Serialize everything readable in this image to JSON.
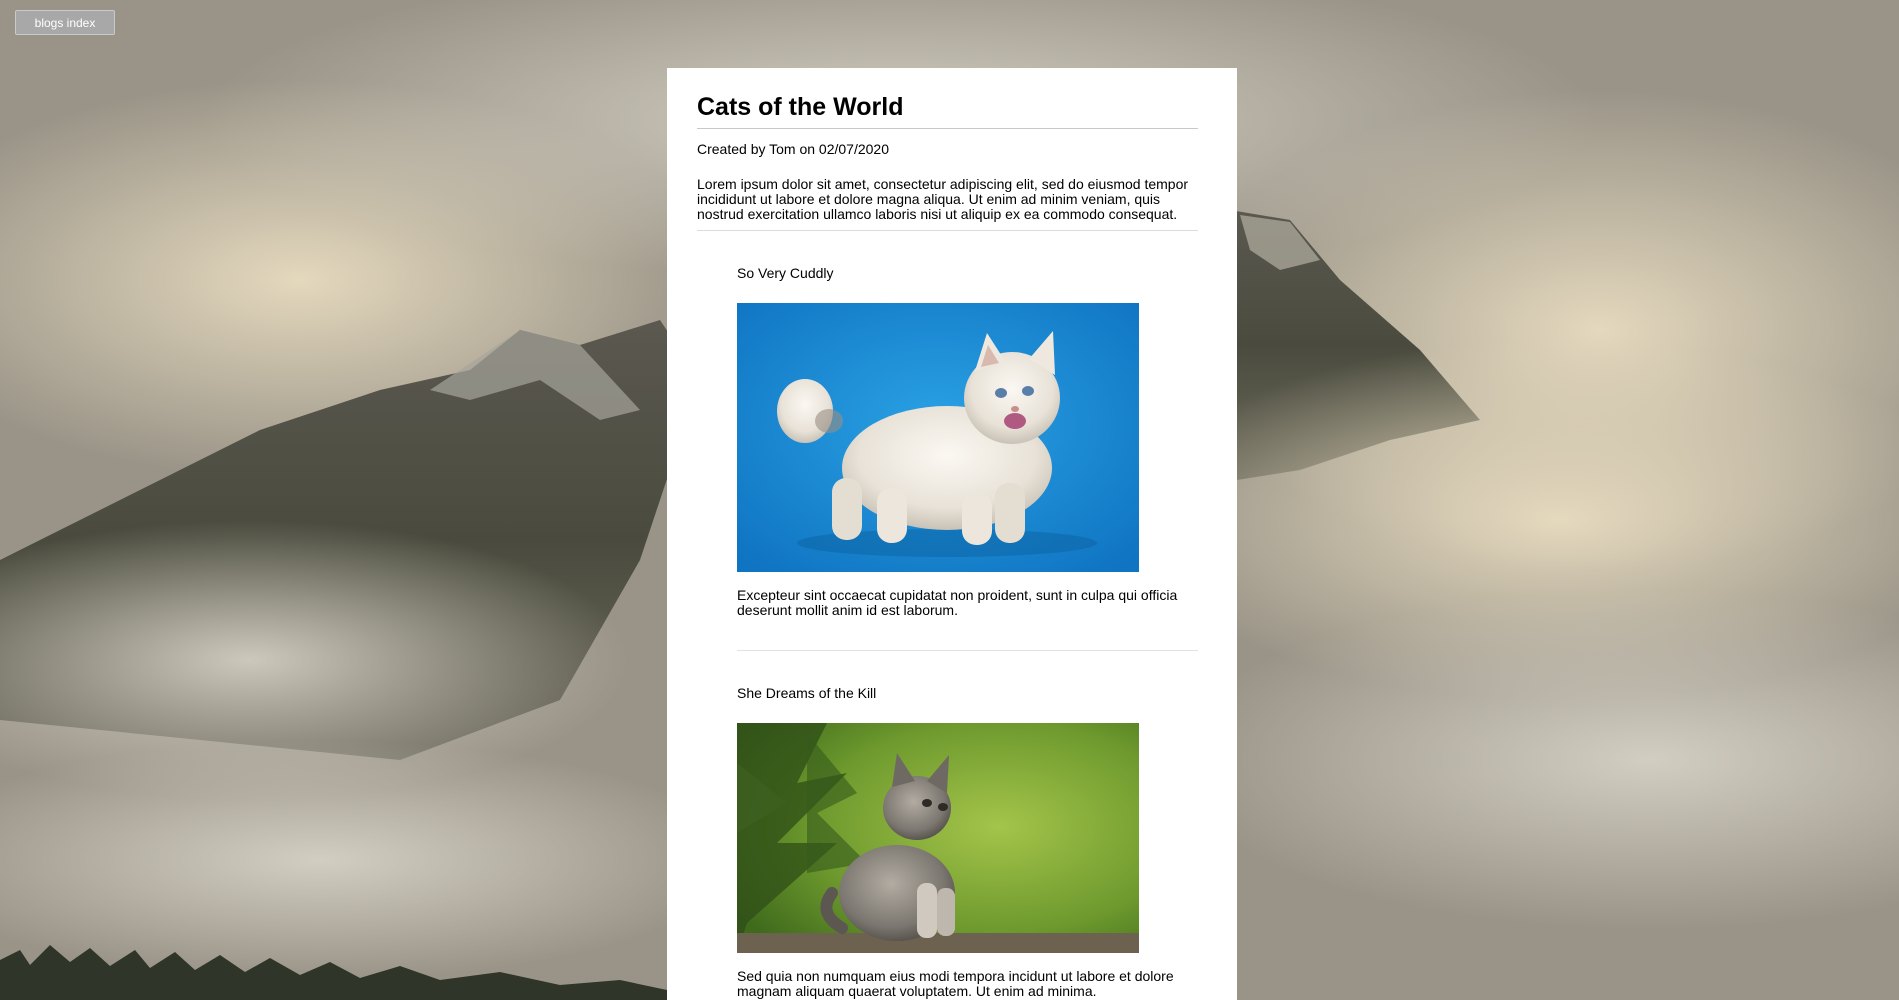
{
  "nav": {
    "blogs_index_label": "blogs index"
  },
  "post": {
    "title": "Cats of the World",
    "meta": "Created by Tom on 02/07/2020",
    "intro": "Lorem ipsum dolor sit amet, consectetur adipiscing elit, sed do eiusmod tempor incididunt ut labore et dolore magna aliqua. Ut enim ad minim veniam, quis nostrud exercitation ullamco laboris nisi ut aliquip ex ea commodo consequat.",
    "sections": [
      {
        "heading": "So Very Cuddly",
        "image": "fluffy-white-kitten-on-blue-background",
        "text": "Excepteur sint occaecat cupidatat non proident, sunt in culpa qui officia deserunt mollit anim id est laborum."
      },
      {
        "heading": "She Dreams of the Kill",
        "image": "grey-tabby-kitten-in-green-foliage",
        "text": "Sed quia non numquam eius modi tempora incidunt ut labore et dolore magnam aliquam quaerat voluptatem. Ut enim ad minima."
      }
    ]
  },
  "colors": {
    "card_background": "#ffffff",
    "button_background": "#a8a8a8",
    "kitten_backdrop_blue": "#1f8fd6",
    "foliage_green": "#7aa536"
  }
}
